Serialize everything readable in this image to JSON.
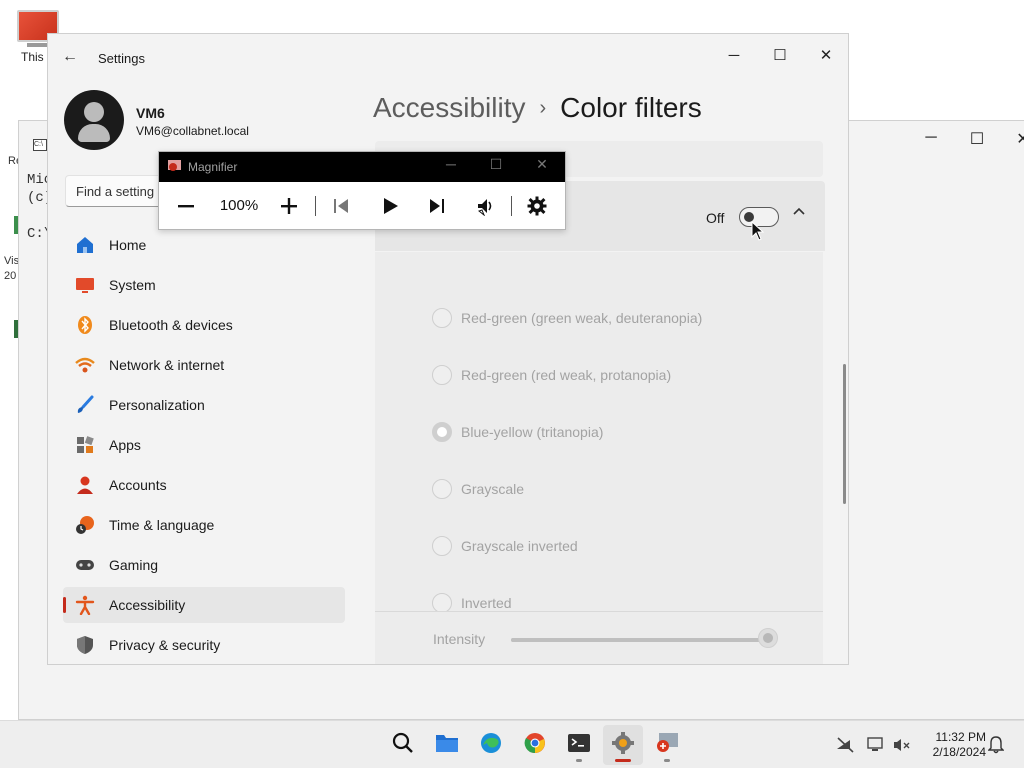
{
  "desktop": {
    "this_pc_label": "This P",
    "frag_re": "Re",
    "frag_vis": "Vis",
    "frag_20": "20"
  },
  "console": {
    "lines": [
      "Mic",
      "(c)",
      "",
      "C:\\"
    ]
  },
  "settings": {
    "app_title": "Settings",
    "profile": {
      "name": "VM6",
      "email": "VM6@collabnet.local"
    },
    "search_placeholder": "Find a setting",
    "nav": [
      {
        "label": "Home",
        "icon": "home-icon"
      },
      {
        "label": "System",
        "icon": "system-icon"
      },
      {
        "label": "Bluetooth & devices",
        "icon": "bluetooth-icon"
      },
      {
        "label": "Network & internet",
        "icon": "wifi-icon"
      },
      {
        "label": "Personalization",
        "icon": "brush-icon"
      },
      {
        "label": "Apps",
        "icon": "apps-icon"
      },
      {
        "label": "Accounts",
        "icon": "accounts-icon"
      },
      {
        "label": "Time & language",
        "icon": "time-language-icon"
      },
      {
        "label": "Gaming",
        "icon": "gamepad-icon"
      },
      {
        "label": "Accessibility",
        "icon": "accessibility-icon",
        "active": true
      },
      {
        "label": "Privacy & security",
        "icon": "shield-icon"
      }
    ],
    "breadcrumb": {
      "parent": "Accessibility",
      "separator": "›",
      "current": "Color filters"
    },
    "color_filters_toggle": {
      "state_label": "Off",
      "on": false
    },
    "filter_options": [
      {
        "label": "Red-green (green weak, deuteranopia)",
        "selected": false
      },
      {
        "label": "Red-green (red weak, protanopia)",
        "selected": false
      },
      {
        "label": "Blue-yellow (tritanopia)",
        "selected": true
      },
      {
        "label": "Grayscale",
        "selected": false
      },
      {
        "label": "Grayscale inverted",
        "selected": false
      },
      {
        "label": "Inverted",
        "selected": false
      }
    ],
    "intensity": {
      "label": "Intensity",
      "value_fraction": 0.99
    }
  },
  "magnifier": {
    "title": "Magnifier",
    "zoom": "100%"
  },
  "taskbar": {
    "apps": [
      "search-icon",
      "file-explorer-icon",
      "edge-icon",
      "chrome-icon",
      "terminal-icon",
      "settings-icon",
      "magnifier-icon"
    ],
    "active_app": "settings-icon",
    "clock_time": "11:32 PM",
    "clock_date": "2/18/2024"
  },
  "colors": {
    "accent": "#c42b1c",
    "window_bg": "#f3f3f3",
    "disabled_text": "#a3a3a3"
  }
}
